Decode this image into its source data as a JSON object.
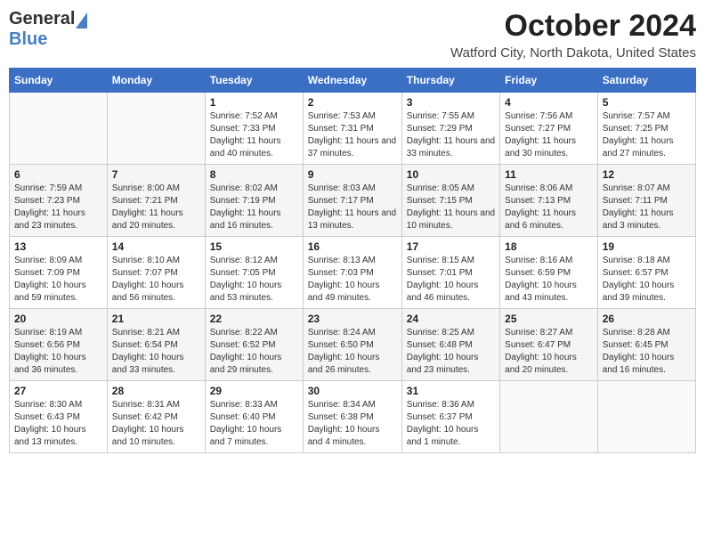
{
  "header": {
    "logo_general": "General",
    "logo_blue": "Blue",
    "title": "October 2024",
    "subtitle": "Watford City, North Dakota, United States"
  },
  "weekdays": [
    "Sunday",
    "Monday",
    "Tuesday",
    "Wednesday",
    "Thursday",
    "Friday",
    "Saturday"
  ],
  "weeks": [
    [
      {
        "day": "",
        "info": ""
      },
      {
        "day": "",
        "info": ""
      },
      {
        "day": "1",
        "info": "Sunrise: 7:52 AM\nSunset: 7:33 PM\nDaylight: 11 hours and 40 minutes."
      },
      {
        "day": "2",
        "info": "Sunrise: 7:53 AM\nSunset: 7:31 PM\nDaylight: 11 hours and 37 minutes."
      },
      {
        "day": "3",
        "info": "Sunrise: 7:55 AM\nSunset: 7:29 PM\nDaylight: 11 hours and 33 minutes."
      },
      {
        "day": "4",
        "info": "Sunrise: 7:56 AM\nSunset: 7:27 PM\nDaylight: 11 hours and 30 minutes."
      },
      {
        "day": "5",
        "info": "Sunrise: 7:57 AM\nSunset: 7:25 PM\nDaylight: 11 hours and 27 minutes."
      }
    ],
    [
      {
        "day": "6",
        "info": "Sunrise: 7:59 AM\nSunset: 7:23 PM\nDaylight: 11 hours and 23 minutes."
      },
      {
        "day": "7",
        "info": "Sunrise: 8:00 AM\nSunset: 7:21 PM\nDaylight: 11 hours and 20 minutes."
      },
      {
        "day": "8",
        "info": "Sunrise: 8:02 AM\nSunset: 7:19 PM\nDaylight: 11 hours and 16 minutes."
      },
      {
        "day": "9",
        "info": "Sunrise: 8:03 AM\nSunset: 7:17 PM\nDaylight: 11 hours and 13 minutes."
      },
      {
        "day": "10",
        "info": "Sunrise: 8:05 AM\nSunset: 7:15 PM\nDaylight: 11 hours and 10 minutes."
      },
      {
        "day": "11",
        "info": "Sunrise: 8:06 AM\nSunset: 7:13 PM\nDaylight: 11 hours and 6 minutes."
      },
      {
        "day": "12",
        "info": "Sunrise: 8:07 AM\nSunset: 7:11 PM\nDaylight: 11 hours and 3 minutes."
      }
    ],
    [
      {
        "day": "13",
        "info": "Sunrise: 8:09 AM\nSunset: 7:09 PM\nDaylight: 10 hours and 59 minutes."
      },
      {
        "day": "14",
        "info": "Sunrise: 8:10 AM\nSunset: 7:07 PM\nDaylight: 10 hours and 56 minutes."
      },
      {
        "day": "15",
        "info": "Sunrise: 8:12 AM\nSunset: 7:05 PM\nDaylight: 10 hours and 53 minutes."
      },
      {
        "day": "16",
        "info": "Sunrise: 8:13 AM\nSunset: 7:03 PM\nDaylight: 10 hours and 49 minutes."
      },
      {
        "day": "17",
        "info": "Sunrise: 8:15 AM\nSunset: 7:01 PM\nDaylight: 10 hours and 46 minutes."
      },
      {
        "day": "18",
        "info": "Sunrise: 8:16 AM\nSunset: 6:59 PM\nDaylight: 10 hours and 43 minutes."
      },
      {
        "day": "19",
        "info": "Sunrise: 8:18 AM\nSunset: 6:57 PM\nDaylight: 10 hours and 39 minutes."
      }
    ],
    [
      {
        "day": "20",
        "info": "Sunrise: 8:19 AM\nSunset: 6:56 PM\nDaylight: 10 hours and 36 minutes."
      },
      {
        "day": "21",
        "info": "Sunrise: 8:21 AM\nSunset: 6:54 PM\nDaylight: 10 hours and 33 minutes."
      },
      {
        "day": "22",
        "info": "Sunrise: 8:22 AM\nSunset: 6:52 PM\nDaylight: 10 hours and 29 minutes."
      },
      {
        "day": "23",
        "info": "Sunrise: 8:24 AM\nSunset: 6:50 PM\nDaylight: 10 hours and 26 minutes."
      },
      {
        "day": "24",
        "info": "Sunrise: 8:25 AM\nSunset: 6:48 PM\nDaylight: 10 hours and 23 minutes."
      },
      {
        "day": "25",
        "info": "Sunrise: 8:27 AM\nSunset: 6:47 PM\nDaylight: 10 hours and 20 minutes."
      },
      {
        "day": "26",
        "info": "Sunrise: 8:28 AM\nSunset: 6:45 PM\nDaylight: 10 hours and 16 minutes."
      }
    ],
    [
      {
        "day": "27",
        "info": "Sunrise: 8:30 AM\nSunset: 6:43 PM\nDaylight: 10 hours and 13 minutes."
      },
      {
        "day": "28",
        "info": "Sunrise: 8:31 AM\nSunset: 6:42 PM\nDaylight: 10 hours and 10 minutes."
      },
      {
        "day": "29",
        "info": "Sunrise: 8:33 AM\nSunset: 6:40 PM\nDaylight: 10 hours and 7 minutes."
      },
      {
        "day": "30",
        "info": "Sunrise: 8:34 AM\nSunset: 6:38 PM\nDaylight: 10 hours and 4 minutes."
      },
      {
        "day": "31",
        "info": "Sunrise: 8:36 AM\nSunset: 6:37 PM\nDaylight: 10 hours and 1 minute."
      },
      {
        "day": "",
        "info": ""
      },
      {
        "day": "",
        "info": ""
      }
    ]
  ]
}
